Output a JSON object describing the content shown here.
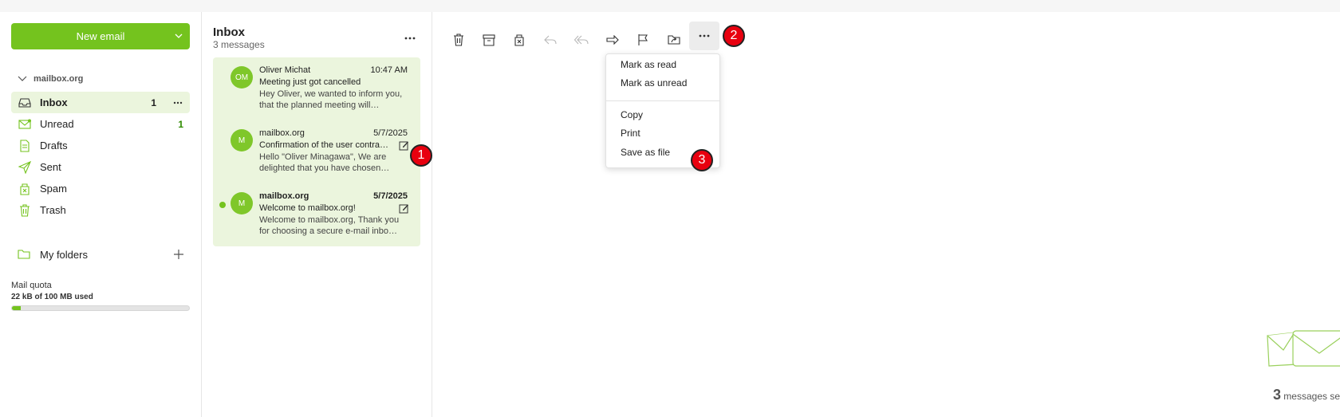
{
  "sidebar": {
    "new_email_label": "New email",
    "account": "mailbox.org",
    "items": [
      {
        "label": "Inbox",
        "count": "1",
        "icon": "inbox-icon",
        "active": true
      },
      {
        "label": "Unread",
        "count": "1",
        "icon": "unread-icon"
      },
      {
        "label": "Drafts",
        "count": "",
        "icon": "drafts-icon"
      },
      {
        "label": "Sent",
        "count": "",
        "icon": "sent-icon"
      },
      {
        "label": "Spam",
        "count": "",
        "icon": "spam-icon"
      },
      {
        "label": "Trash",
        "count": "",
        "icon": "trash-icon"
      }
    ],
    "my_folders": "My folders",
    "quota": {
      "title": "Mail quota",
      "used": "22 kB of 100 MB used",
      "fraction": 0.05
    }
  },
  "list": {
    "title": "Inbox",
    "subtitle": "3 messages",
    "messages": [
      {
        "initials": "OM",
        "from": "Oliver Michat",
        "date": "10:47 AM",
        "subject": "Meeting just got cancelled",
        "preview": "Hey Oliver, we wanted to inform you, that the planned meeting will…",
        "unread": false
      },
      {
        "initials": "M",
        "from": "mailbox.org",
        "date": "5/7/2025",
        "subject": "Confirmation of the user contra…",
        "preview": "Hello \"Oliver Minagawa\", We are delighted that you have chosen…",
        "unread": false
      },
      {
        "initials": "M",
        "from": "mailbox.org",
        "date": "5/7/2025",
        "subject": "Welcome to mailbox.org!",
        "preview": "Welcome to mailbox.org, Thank you for choosing a secure e-mail inbo…",
        "unread": true
      }
    ]
  },
  "menu": {
    "items": [
      "Mark as read",
      "Mark as unread",
      "Copy",
      "Print",
      "Save as file"
    ]
  },
  "badges": [
    "1",
    "2",
    "3"
  ],
  "selection": {
    "count": "3",
    "label": " messages selected"
  },
  "colors": {
    "accent": "#74c31e",
    "badge": "#e8000f",
    "selected_bg": "#ebf5dd"
  }
}
